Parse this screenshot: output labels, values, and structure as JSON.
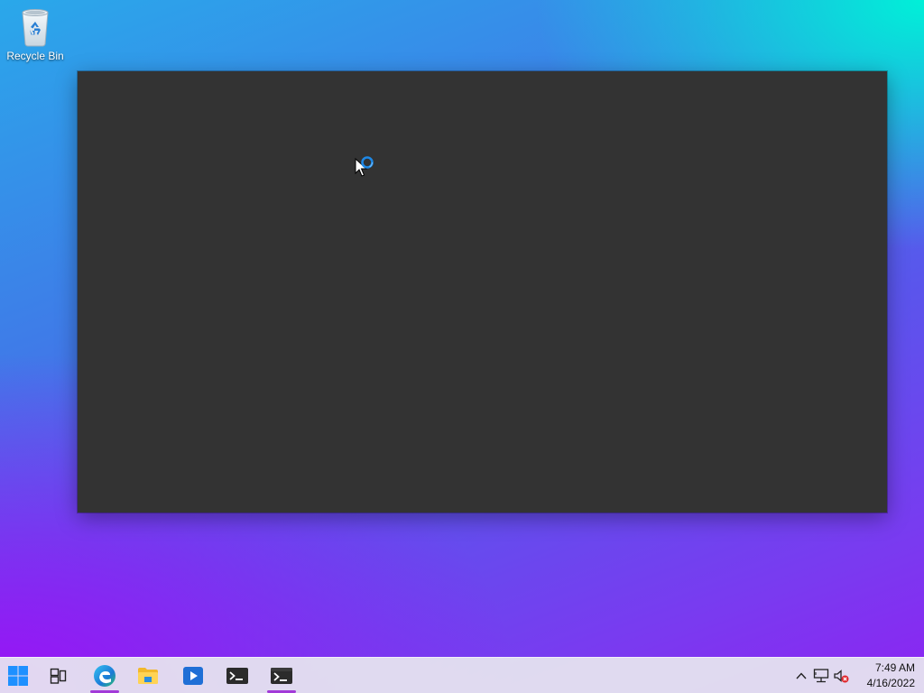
{
  "desktop": {
    "icons": [
      {
        "label": "Recycle Bin",
        "icon": "recycle-bin-icon"
      }
    ]
  },
  "window": {
    "state": "loading",
    "background": "#333333"
  },
  "cursor": {
    "icon": "busy-cursor-icon"
  },
  "taskbar": {
    "accent": "#a23ad8",
    "apps": [
      {
        "name": "Start",
        "icon": "windows-start-icon",
        "active": false
      },
      {
        "name": "Task View",
        "icon": "task-view-icon",
        "active": false
      },
      {
        "name": "Microsoft Edge",
        "icon": "edge-icon",
        "active": true
      },
      {
        "name": "File Explorer",
        "icon": "folder-icon",
        "active": false
      },
      {
        "name": "Media Player",
        "icon": "media-player-icon",
        "active": false
      },
      {
        "name": "Terminal",
        "icon": "terminal-icon",
        "active": false
      },
      {
        "name": "Terminal",
        "icon": "terminal-icon",
        "active": true
      }
    ],
    "tray": {
      "icons": [
        "chevron-up-icon",
        "network-icon",
        "volume-muted-icon"
      ],
      "time": "7:49 AM",
      "date": "4/16/2022"
    }
  }
}
